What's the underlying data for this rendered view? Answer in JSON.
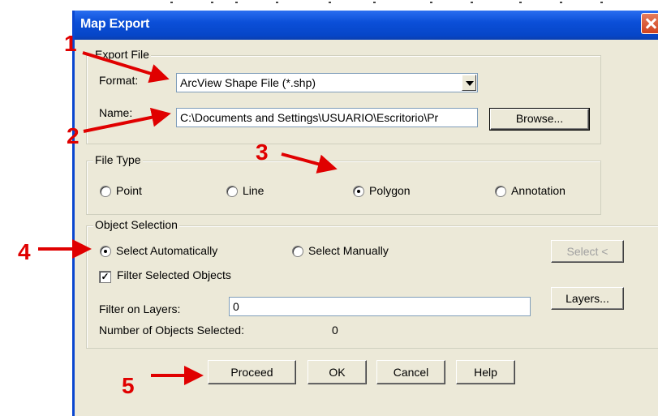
{
  "window": {
    "title": "Map Export"
  },
  "export_file": {
    "group_label": "Export File",
    "format_label": "Format:",
    "format_value": "ArcView Shape File (*.shp)",
    "name_label": "Name:",
    "name_value": "C:\\Documents and Settings\\USUARIO\\Escritorio\\Pr",
    "browse_label": "Browse..."
  },
  "file_type": {
    "group_label": "File Type",
    "options": [
      "Point",
      "Line",
      "Polygon",
      "Annotation"
    ],
    "selected": "Polygon"
  },
  "object_selection": {
    "group_label": "Object Selection",
    "auto_label": "Select Automatically",
    "manual_label": "Select Manually",
    "selected": "Select Automatically",
    "select_button_label": "Select <",
    "filter_selected_label": "Filter Selected Objects",
    "filter_selected_checked": true,
    "filter_layers_label": "Filter on Layers:",
    "filter_layers_value": "0",
    "layers_button_label": "Layers...",
    "count_label": "Number of Objects Selected:",
    "count_value": "0"
  },
  "buttons": {
    "proceed": "Proceed",
    "ok": "OK",
    "cancel": "Cancel",
    "help": "Help"
  },
  "annotations": {
    "labels": [
      "1",
      "2",
      "3",
      "4",
      "5"
    ],
    "color": "#e00000"
  },
  "icons": {
    "close": "close-icon",
    "dropdown": "chevron-down-icon",
    "check": "check-icon"
  }
}
